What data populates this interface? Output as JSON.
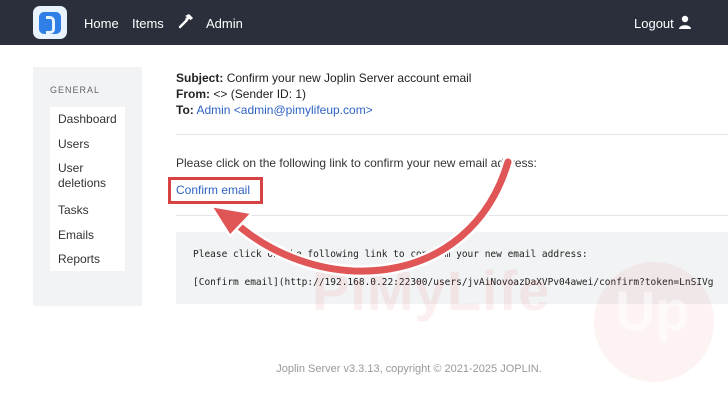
{
  "nav": {
    "home": "Home",
    "items": "Items",
    "admin": "Admin",
    "logout": "Logout"
  },
  "sidebar": {
    "heading": "GENERAL",
    "items": [
      {
        "label": "Dashboard"
      },
      {
        "label": "Users"
      },
      {
        "label": "User deletions"
      },
      {
        "label": "Tasks"
      },
      {
        "label": "Emails"
      },
      {
        "label": "Reports"
      }
    ]
  },
  "email": {
    "subject_label": "Subject:",
    "subject": "Confirm your new Joplin Server account email",
    "from_label": "From:",
    "from": "<> (Sender ID: 1)",
    "to_label": "To:",
    "to": "Admin <admin@pimylifeup.com>",
    "body": "Please click on the following link to confirm your new email address:",
    "confirm_link": "Confirm email",
    "code_line1": "Please click on the following link to confirm your new email address:",
    "code_line2": "[Confirm email](http://192.168.0.22:22300/users/jvAiNovoazDaXVPv04awei/confirm?token=LnSIVg"
  },
  "footer": "Joplin Server v3.3.13, copyright © 2021-2025 JOPLIN.",
  "watermark": {
    "text": "PiMyLife",
    "badge": "Up"
  },
  "colors": {
    "navbar": "#2b2f3b",
    "link": "#2f63c3",
    "highlight": "#d84242",
    "arrow": "#e05555"
  }
}
